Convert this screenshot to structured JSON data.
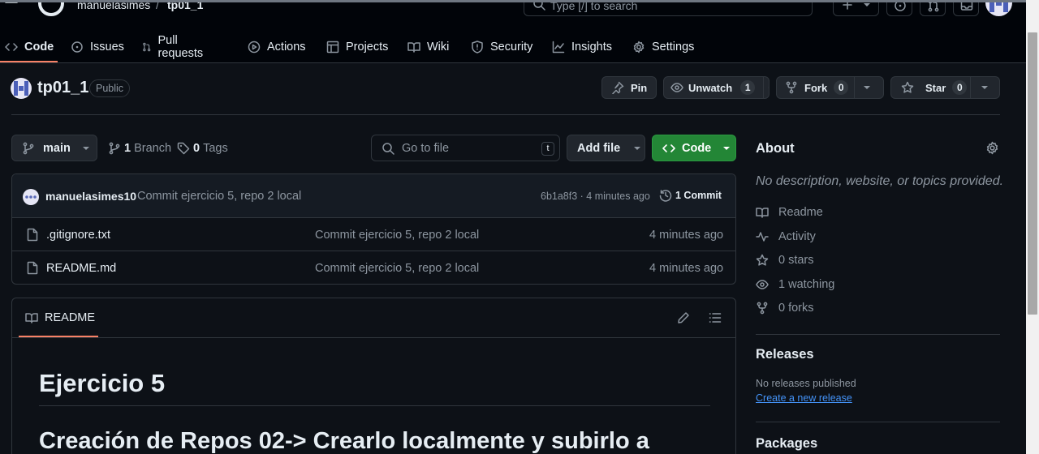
{
  "header": {
    "owner": "manuelasimes",
    "separator": "/",
    "repo": "tp01_1",
    "search_placeholder": "Type [/] to search"
  },
  "tabs": [
    {
      "label": "Code",
      "icon": "code-icon"
    },
    {
      "label": "Issues",
      "icon": "issue-icon"
    },
    {
      "label": "Pull requests",
      "icon": "pull-request-icon"
    },
    {
      "label": "Actions",
      "icon": "play-icon"
    },
    {
      "label": "Projects",
      "icon": "table-icon"
    },
    {
      "label": "Wiki",
      "icon": "book-icon"
    },
    {
      "label": "Security",
      "icon": "shield-icon"
    },
    {
      "label": "Insights",
      "icon": "graph-icon"
    },
    {
      "label": "Settings",
      "icon": "gear-icon"
    }
  ],
  "repo": {
    "name": "tp01_1",
    "visibility": "Public",
    "pin_label": "Pin",
    "unwatch_label": "Unwatch",
    "watch_count": "1",
    "fork_label": "Fork",
    "fork_count": "0",
    "star_label": "Star",
    "star_count": "0"
  },
  "toolbar": {
    "branch": "main",
    "branch_count": "1",
    "branch_label": "Branch",
    "tag_count": "0",
    "tag_label": "Tags",
    "go_to_file": "Go to file",
    "kbd": "t",
    "add_file": "Add file",
    "code": "Code"
  },
  "commit": {
    "author": "manuelasimes10",
    "message": "Commit ejercicio 5, repo 2 local",
    "sha_time": "6b1a8f3 · 4 minutes ago",
    "count_label": "1 Commit"
  },
  "files": [
    {
      "name": ".gitignore.txt",
      "message": "Commit ejercicio 5, repo 2 local",
      "time": "4 minutes ago"
    },
    {
      "name": "README.md",
      "message": "Commit ejercicio 5, repo 2 local",
      "time": "4 minutes ago"
    }
  ],
  "readme": {
    "tab": "README",
    "h1": "Ejercicio 5",
    "h2": "Creación de Repos 02-> Crearlo localmente y subirlo a"
  },
  "about": {
    "title": "About",
    "description": "No description, website, or topics provided.",
    "readme": "Readme",
    "activity": "Activity",
    "stars": "0 stars",
    "watching": "1 watching",
    "forks": "0 forks"
  },
  "releases": {
    "title": "Releases",
    "none": "No releases published",
    "create_link": "Create a new release"
  },
  "packages": {
    "title": "Packages"
  },
  "colors": {
    "background": "#0d1117",
    "header": "#010409",
    "border": "#30363d",
    "muted": "#8d96a0",
    "green_button": "#238636",
    "accent_underline": "#f78166",
    "link": "#4493f8"
  }
}
